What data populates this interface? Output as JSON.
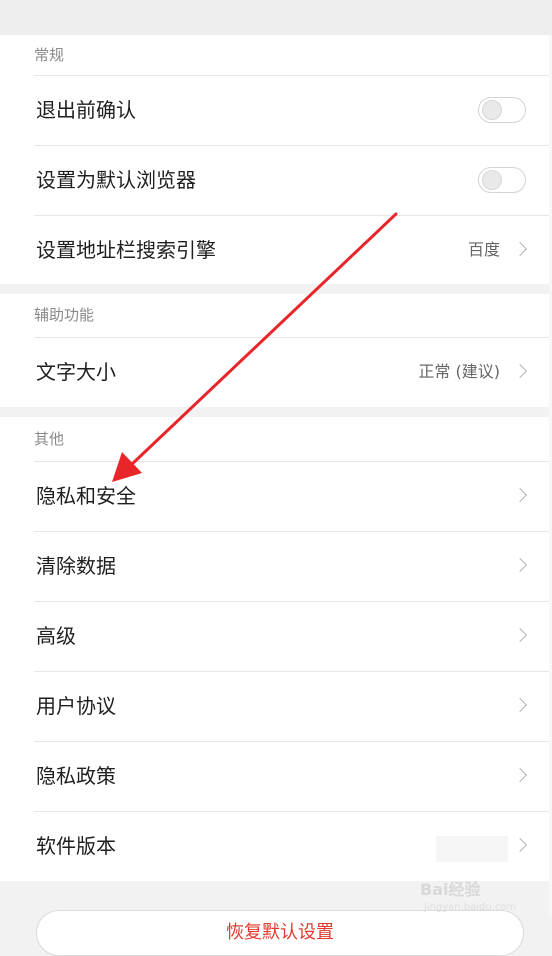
{
  "sections": [
    {
      "header": "常规",
      "rows": [
        {
          "label": "退出前确认",
          "type": "toggle",
          "on": false
        },
        {
          "label": "设置为默认浏览器",
          "type": "toggle",
          "on": false
        },
        {
          "label": "设置地址栏搜索引擎",
          "type": "link",
          "value": "百度"
        }
      ]
    },
    {
      "header": "辅助功能",
      "rows": [
        {
          "label": "文字大小",
          "type": "link",
          "value": "正常 (建议)"
        }
      ]
    },
    {
      "header": "其他",
      "rows": [
        {
          "label": "隐私和安全",
          "type": "link"
        },
        {
          "label": "清除数据",
          "type": "link"
        },
        {
          "label": "高级",
          "type": "link"
        },
        {
          "label": "用户协议",
          "type": "link"
        },
        {
          "label": "隐私政策",
          "type": "link"
        },
        {
          "label": "软件版本",
          "type": "link"
        }
      ]
    }
  ],
  "bottom_button": "恢复默认设置",
  "annotation": {
    "color": "#e8262a"
  },
  "watermark": {
    "brand": "Bai经验",
    "sub": "jingyan.baidu.com"
  }
}
